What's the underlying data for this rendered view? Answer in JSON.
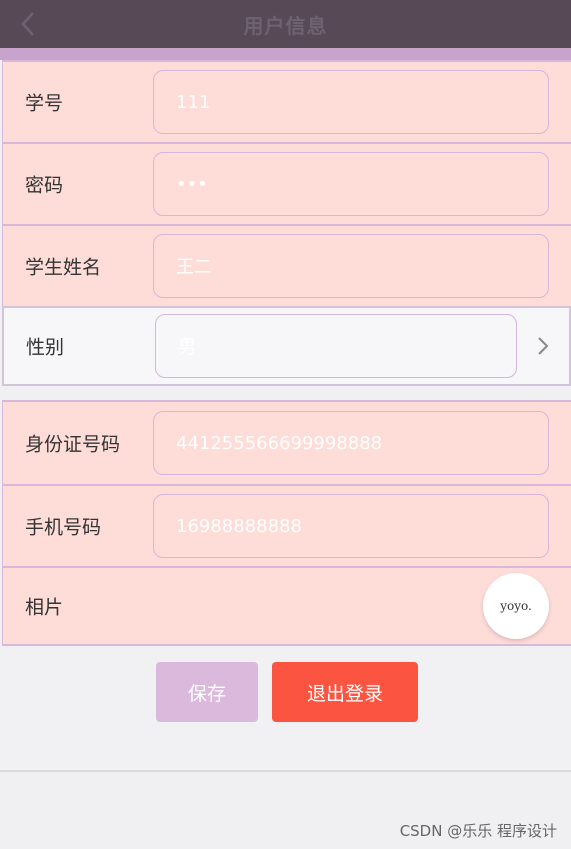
{
  "header": {
    "title": "用户信息"
  },
  "form": {
    "student_id": {
      "label": "学号",
      "value": "111"
    },
    "password": {
      "label": "密码",
      "value": "•••"
    },
    "student_name": {
      "label": "学生姓名",
      "value": "王二"
    },
    "gender": {
      "label": "性别",
      "value": "男"
    },
    "id_number": {
      "label": "身份证号码",
      "value": "441255566699998888"
    },
    "phone": {
      "label": "手机号码",
      "value": "16988888888"
    },
    "photo": {
      "label": "相片",
      "avatar_text": "yoyo."
    }
  },
  "actions": {
    "save_label": "保存",
    "logout_label": "退出登录"
  },
  "watermark": "CSDN @乐乐 程序设计",
  "colors": {
    "header_bg": "#574956",
    "accent": "#c8a4cc",
    "row_bg": "#fedcd8",
    "logout": "#fb5440",
    "save": "#dbb9dd"
  }
}
